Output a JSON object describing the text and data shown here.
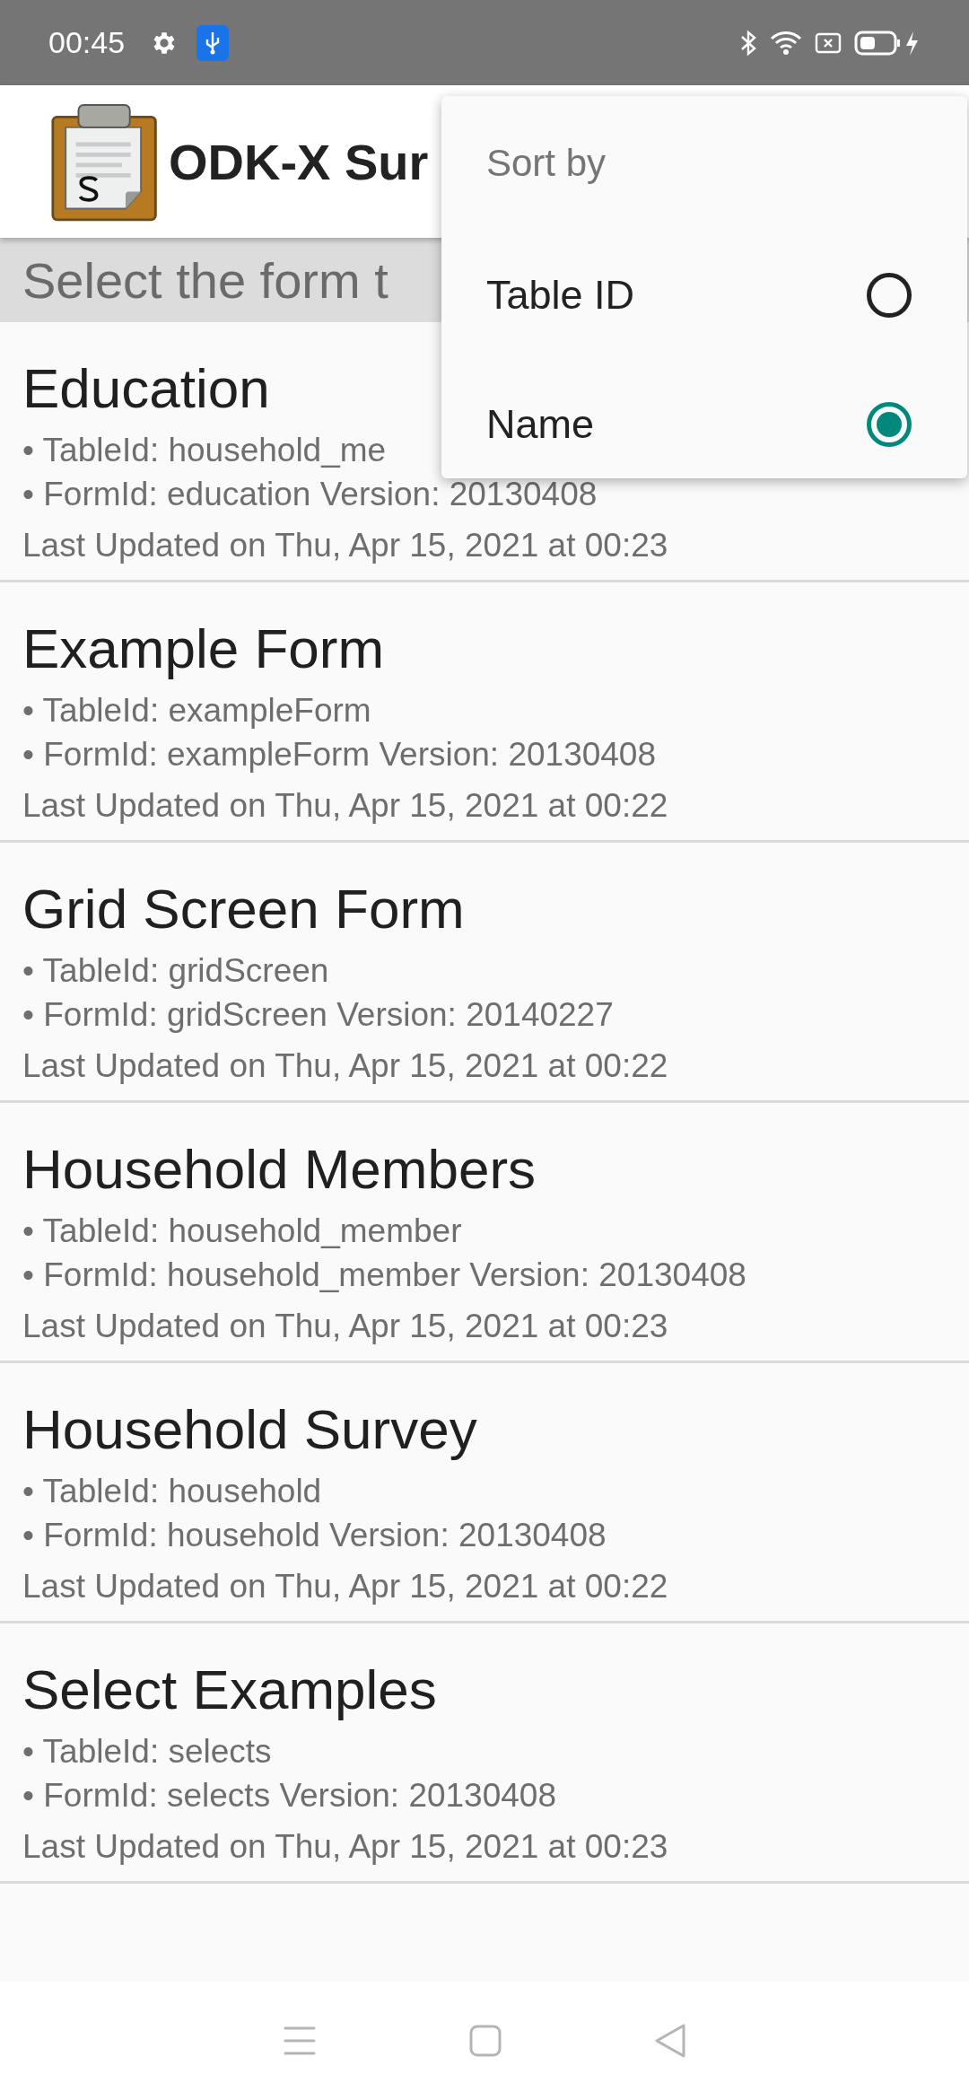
{
  "status_bar": {
    "time": "00:45"
  },
  "app_bar": {
    "title": "ODK-X Sur"
  },
  "subtitle": "Select the form t",
  "forms": [
    {
      "name": "Education",
      "table_id": "• TableId: household_me",
      "form_id": "• FormId: education Version: 20130408",
      "updated": "Last Updated on Thu, Apr 15, 2021 at 00:23"
    },
    {
      "name": "Example Form",
      "table_id": "• TableId: exampleForm",
      "form_id": "• FormId: exampleForm Version: 20130408",
      "updated": "Last Updated on Thu, Apr 15, 2021 at 00:22"
    },
    {
      "name": "Grid Screen Form",
      "table_id": "• TableId: gridScreen",
      "form_id": "• FormId: gridScreen Version: 20140227",
      "updated": "Last Updated on Thu, Apr 15, 2021 at 00:22"
    },
    {
      "name": "Household Members",
      "table_id": "• TableId: household_member",
      "form_id": "• FormId: household_member Version: 20130408",
      "updated": "Last Updated on Thu, Apr 15, 2021 at 00:23"
    },
    {
      "name": "Household Survey",
      "table_id": "• TableId: household",
      "form_id": "• FormId: household Version: 20130408",
      "updated": "Last Updated on Thu, Apr 15, 2021 at 00:22"
    },
    {
      "name": "Select Examples",
      "table_id": "• TableId: selects",
      "form_id": "• FormId: selects Version: 20130408",
      "updated": "Last Updated on Thu, Apr 15, 2021 at 00:23"
    }
  ],
  "sort_menu": {
    "title": "Sort by",
    "options": [
      {
        "label": "Table ID",
        "selected": false
      },
      {
        "label": "Name",
        "selected": true
      }
    ]
  }
}
